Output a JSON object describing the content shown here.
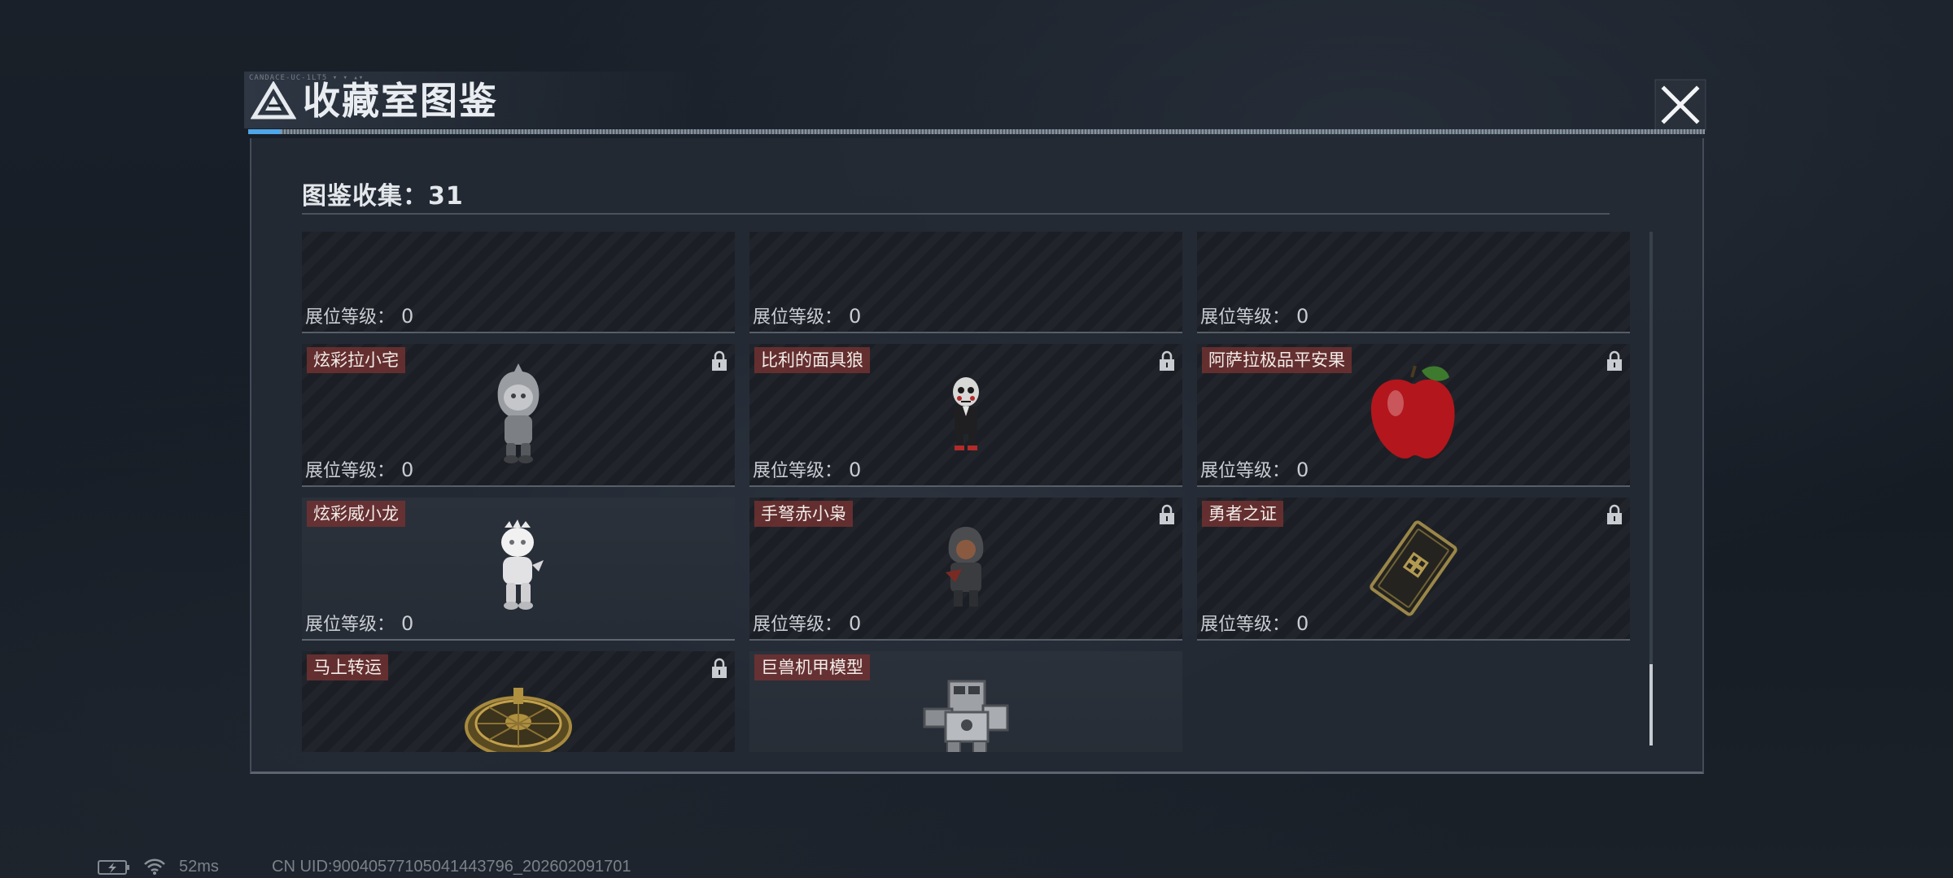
{
  "header": {
    "title": "收藏室图鉴",
    "tiny_text": "CANDACE-UC-1LT5 ▾ ▾ ▴▾"
  },
  "panel": {
    "collection_label": "图鉴收集：31"
  },
  "level_label": "展位等级：",
  "items": [
    {
      "name": "",
      "level": "0",
      "locked": true,
      "icon": "figure-icon"
    },
    {
      "name": "",
      "level": "0",
      "locked": true,
      "icon": "orb-icon"
    },
    {
      "name": "",
      "level": "0",
      "locked": true,
      "icon": "card-icon"
    },
    {
      "name": "炫彩拉小宅",
      "level": "0",
      "locked": true,
      "icon": "hooded-figure-icon"
    },
    {
      "name": "比利的面具狼",
      "level": "0",
      "locked": true,
      "icon": "puppet-figure-icon"
    },
    {
      "name": "阿萨拉极品平安果",
      "level": "0",
      "locked": true,
      "icon": "apple-icon"
    },
    {
      "name": "炫彩威小龙",
      "level": "0",
      "locked": false,
      "icon": "dragon-figure-icon"
    },
    {
      "name": "手弩赤小枭",
      "level": "0",
      "locked": true,
      "icon": "archer-figure-icon"
    },
    {
      "name": "勇者之证",
      "level": "0",
      "locked": true,
      "icon": "badge-card-icon"
    },
    {
      "name": "马上转运",
      "level": "0",
      "locked": true,
      "icon": "wheel-icon"
    },
    {
      "name": "巨兽机甲模型",
      "level": "0",
      "locked": false,
      "icon": "mech-model-icon"
    }
  ],
  "status_bar": {
    "ping": "52ms",
    "uid": "CN UID:900405771050414437​96_202602091701"
  },
  "colors": {
    "name_tag_bg": "#743232",
    "accent_blue": "#4fa6e8",
    "panel_bg": "#242a34"
  }
}
